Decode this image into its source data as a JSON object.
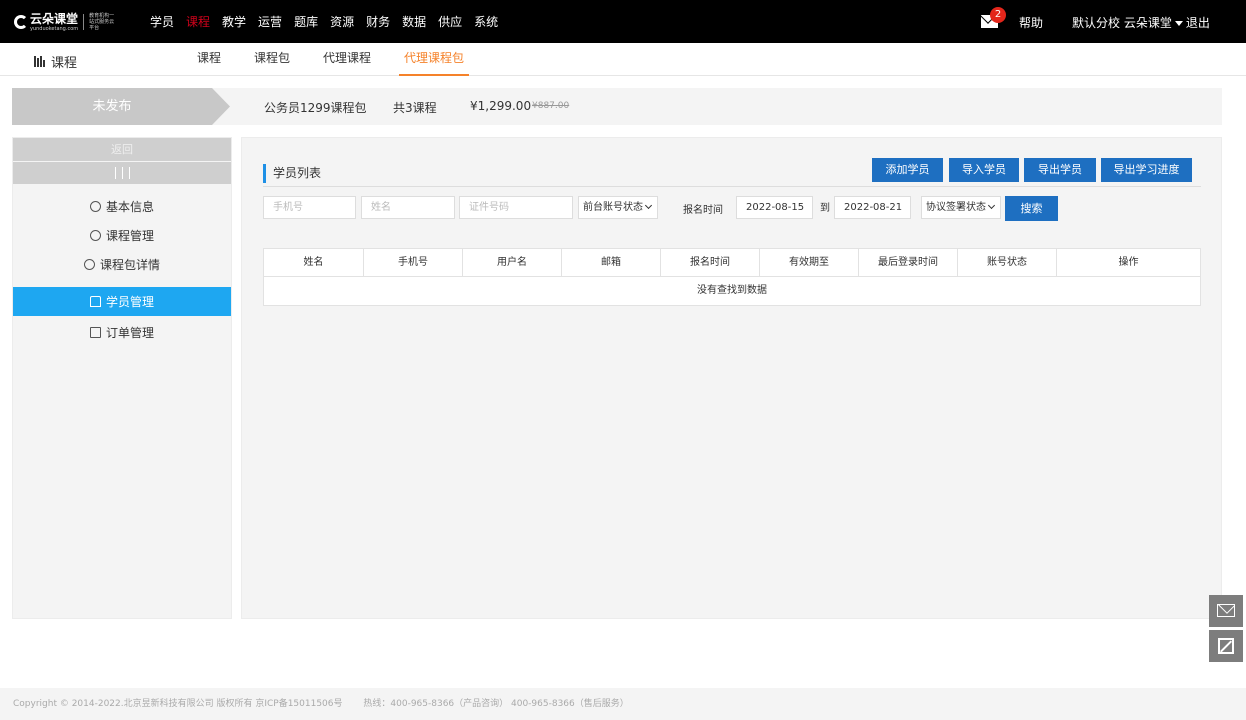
{
  "topbar": {
    "logo_text": "云朵课堂",
    "logo_sub": "yunduoketang.com",
    "logo_slogan": "教育机构一站式服务云平台",
    "nav": [
      "学员",
      "课程",
      "教学",
      "运营",
      "题库",
      "资源",
      "财务",
      "数据",
      "供应",
      "系统"
    ],
    "active_nav": "课程",
    "mail_badge": "2",
    "help": "帮助",
    "school": "默认分校 云朵课堂",
    "logout": "退出"
  },
  "subnav": {
    "title": "课程",
    "tabs": [
      "课程",
      "课程包",
      "代理课程",
      "代理课程包"
    ],
    "active_tab": "代理课程包"
  },
  "strip": {
    "status": "未发布",
    "package_name": "公务员1299课程包",
    "course_count": "共3课程",
    "price": "¥1,299.00",
    "original_price": "¥887.00"
  },
  "sidebar": {
    "back": "返回",
    "items": [
      {
        "label": "基本信息",
        "icon": "list-circle-icon"
      },
      {
        "label": "课程管理",
        "icon": "play-circle-icon"
      },
      {
        "label": "课程包详情",
        "icon": "package-icon"
      },
      {
        "label": "学员管理",
        "icon": "users-icon",
        "active": true
      },
      {
        "label": "订单管理",
        "icon": "clipboard-icon"
      }
    ]
  },
  "panel": {
    "title": "学员列表",
    "buttons": {
      "add": "添加学员",
      "import": "导入学员",
      "export": "导出学员",
      "export_progress": "导出学习进度"
    },
    "filters": {
      "phone_placeholder": "手机号",
      "name_placeholder": "姓名",
      "id_placeholder": "证件号码",
      "account_status": "前台账号状态",
      "signup_time_label": "报名时间",
      "date_from": "2022-08-15",
      "to_label": "到",
      "date_to": "2022-08-21",
      "agreement_status": "协议签署状态",
      "search": "搜索"
    },
    "table": {
      "headers": [
        "姓名",
        "手机号",
        "用户名",
        "邮箱",
        "报名时间",
        "有效期至",
        "最后登录时间",
        "账号状态",
        "操作"
      ],
      "empty": "没有查找到数据"
    }
  },
  "footer": {
    "copyright": "Copyright © 2014-2022.北京昱新科技有限公司 版权所有 京ICP备15011506号",
    "hotline": "热线：400-965-8366（产品咨询） 400-965-8366（售后服务）"
  },
  "colors": {
    "topbar_bg": "#000000",
    "active_nav": "#d0021b",
    "active_tab": "#f5822a",
    "primary_button": "#1e6fc1",
    "sidebar_active": "#1ea7f1"
  }
}
